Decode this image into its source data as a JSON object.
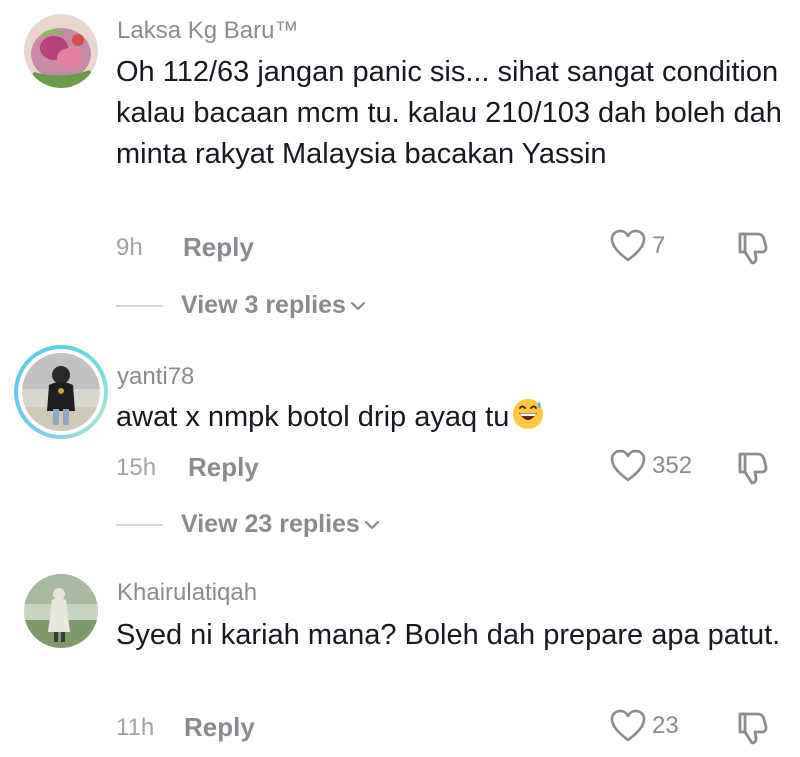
{
  "comments": [
    {
      "username": "Laksa Kg Baru™",
      "text": "Oh 112/63 jangan panic sis... sihat sangat condition kalau bacaan mcm tu. kalau 210/103 dah boleh dah minta rakyat Malaysia bacakan Yassin",
      "time": "9h",
      "reply_label": "Reply",
      "likes": "7",
      "view_replies": "View 3 replies"
    },
    {
      "username": "yanti78",
      "text": "awat x nmpk botol drip ayaq tu",
      "time": "15h",
      "reply_label": "Reply",
      "likes": "352",
      "view_replies": "View 23 replies"
    },
    {
      "username": "Khairulatiqah",
      "text": "Syed ni kariah mana? Boleh dah prepare apa patut.",
      "time": "11h",
      "reply_label": "Reply",
      "likes": "23"
    }
  ],
  "icons": {
    "like": "heart-outline-icon",
    "dislike": "thumbs-down-icon",
    "expand": "chevron-down-icon",
    "emoji": "grinning-face-with-sweat-emoji"
  }
}
